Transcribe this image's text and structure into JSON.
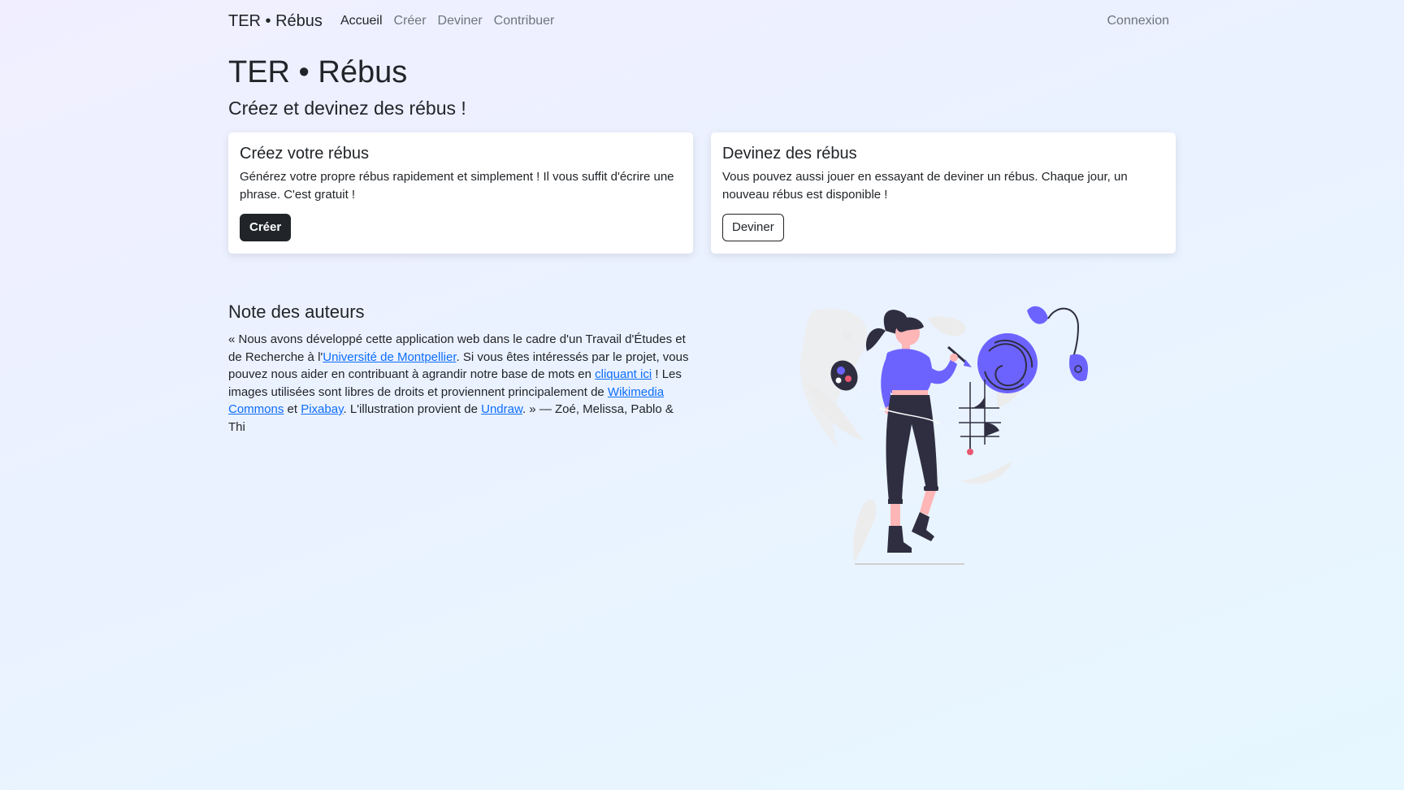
{
  "navbar": {
    "brand": "TER • Rébus",
    "links": [
      {
        "label": "Accueil"
      },
      {
        "label": "Créer"
      },
      {
        "label": "Deviner"
      },
      {
        "label": "Contribuer"
      }
    ],
    "login": "Connexion"
  },
  "hero": {
    "title": "TER • Rébus",
    "subtitle": "Créez et devinez des rébus !"
  },
  "cards": [
    {
      "title": "Créez votre rébus",
      "text": "Générez votre propre rébus rapidement et simplement ! Il vous suffit d'écrire une phrase. C'est gratuit !",
      "button": "Créer"
    },
    {
      "title": "Devinez des rébus",
      "text": "Vous pouvez aussi jouer en essayant de deviner un rébus. Chaque jour, un nouveau rébus est disponible !",
      "button": "Deviner"
    }
  ],
  "note": {
    "title": "Note des auteurs",
    "p1": "« Nous avons développé cette application web dans le cadre d'un Travail d'Études et de Recherche à l'",
    "link_univ": "Université de Montpellier",
    "p2": ". Si vous êtes intéressés par le projet, vous pouvez nous aider en contribuant à agrandir notre base de mots en ",
    "link_here": "cliquant ici",
    "p3": " ! Les images utilisées sont libres de droits et proviennent principalement de ",
    "link_wiki": "Wikimedia Commons",
    "p4": " et ",
    "link_pixabay": "Pixabay",
    "p5": ". L'illustration provient de ",
    "link_undraw": "Undraw",
    "p6": ". » — Zoé, Melissa, Pablo & Thi"
  },
  "colors": {
    "accent": "#6c63ff",
    "dark": "#212529",
    "muted": "#6c757d",
    "link": "#0d6efd",
    "skin": "#ffb6b6",
    "pink": "#e8586f"
  },
  "illustration": {
    "icon": "woman-painting-illustration"
  }
}
